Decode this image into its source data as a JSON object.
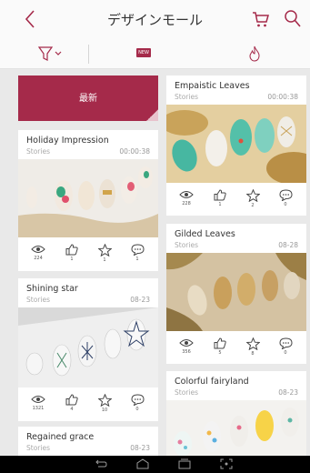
{
  "header": {
    "title": "デザインモール"
  },
  "filters": {
    "new_badge": "NEW"
  },
  "banner": {
    "label": "最新"
  },
  "cards": [
    {
      "title": "Holiday Impression",
      "subtitle": "Stories",
      "date": "00:00:38",
      "views": "224",
      "likes": "1",
      "favorites": "1",
      "comments": "1"
    },
    {
      "title": "Shining star",
      "subtitle": "Stories",
      "date": "08-23",
      "views": "1321",
      "likes": "4",
      "favorites": "10",
      "comments": "0"
    },
    {
      "title": "Regained grace",
      "subtitle": "Stories",
      "date": "08-23"
    },
    {
      "title": "Empaistic Leaves",
      "subtitle": "Stories",
      "date": "00:00:38",
      "views": "228",
      "likes": "1",
      "favorites": "2",
      "comments": "0"
    },
    {
      "title": "Gilded Leaves",
      "subtitle": "Stories",
      "date": "08-28",
      "views": "356",
      "likes": "5",
      "favorites": "8",
      "comments": "0"
    },
    {
      "title": "Colorful fairyland",
      "subtitle": "Stories",
      "date": "08-23"
    }
  ],
  "colors": {
    "accent": "#a52a4a",
    "header_bg": "#fafafa",
    "page_bg": "#e9e9e9"
  },
  "icons": [
    "back-icon",
    "cart-icon",
    "search-icon",
    "filter-icon",
    "fire-icon",
    "eye-icon",
    "thumbs-up-icon",
    "star-icon",
    "comment-icon",
    "nav-back-icon",
    "nav-home-icon",
    "nav-recents-icon",
    "nav-screenshot-icon"
  ]
}
